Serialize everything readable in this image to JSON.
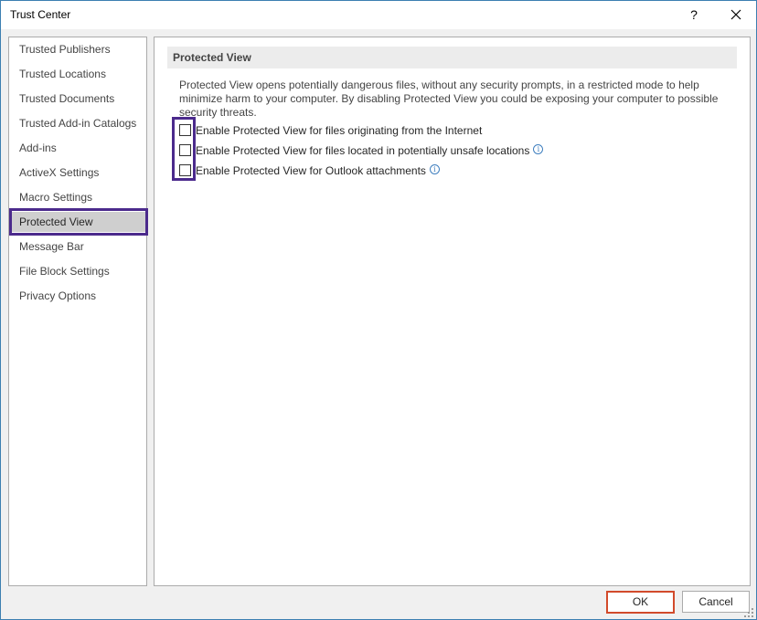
{
  "window": {
    "title": "Trust Center",
    "help_label": "?"
  },
  "sidebar": {
    "items": [
      {
        "label": "Trusted Publishers"
      },
      {
        "label": "Trusted Locations"
      },
      {
        "label": "Trusted Documents"
      },
      {
        "label": "Trusted Add-in Catalogs"
      },
      {
        "label": "Add-ins"
      },
      {
        "label": "ActiveX Settings"
      },
      {
        "label": "Macro Settings"
      },
      {
        "label": "Protected View",
        "selected": true
      },
      {
        "label": "Message Bar"
      },
      {
        "label": "File Block Settings"
      },
      {
        "label": "Privacy Options"
      }
    ]
  },
  "main": {
    "section_title": "Protected View",
    "description": "Protected View opens potentially dangerous files, without any security prompts, in a restricted mode to help minimize harm to your computer. By disabling Protected View you could be exposing your computer to possible security threats.",
    "options": [
      {
        "label": "Enable Protected View for files originating from the Internet",
        "checked": false,
        "info": false
      },
      {
        "label": "Enable Protected View for files located in potentially unsafe locations",
        "checked": false,
        "info": true
      },
      {
        "label": "Enable Protected View for Outlook attachments",
        "checked": false,
        "info": true
      }
    ],
    "info_glyph": "i"
  },
  "footer": {
    "ok_label": "OK",
    "cancel_label": "Cancel"
  },
  "colors": {
    "highlight_outline": "#4b2a8c",
    "ok_border": "#d24a2b",
    "info_icon": "#3f7fbf",
    "window_border": "#3c7fb1"
  }
}
